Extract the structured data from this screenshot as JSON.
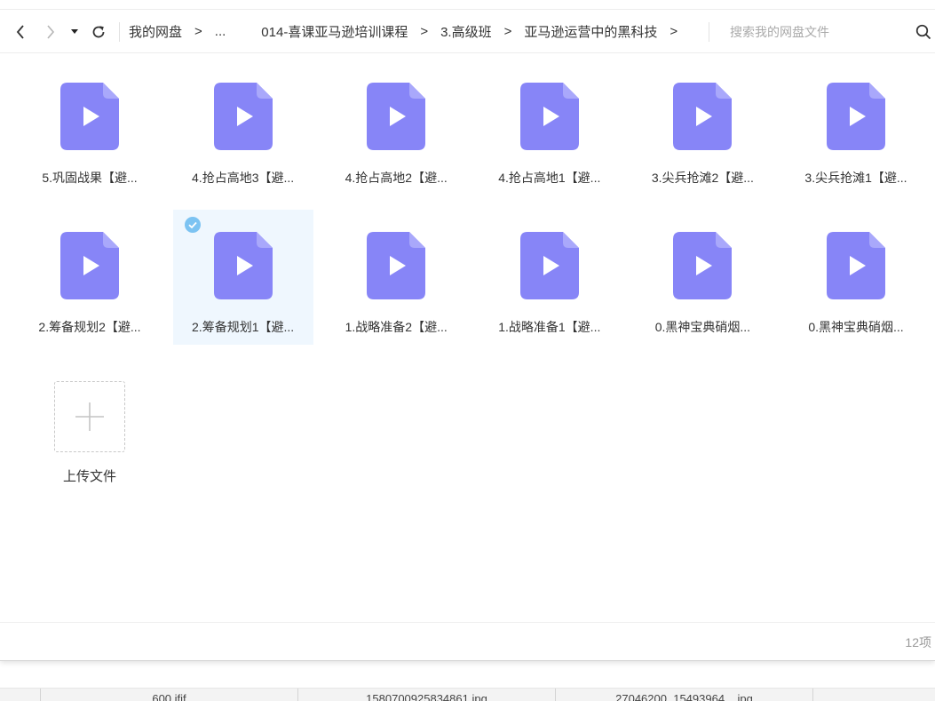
{
  "toolbar": {
    "icons": [
      "chevron-left-icon",
      "chevron-right-icon",
      "caret-down-icon",
      "refresh-icon"
    ]
  },
  "breadcrumb": {
    "items": [
      "我的网盘",
      "...",
      "014-喜课亚马逊培训课程",
      "3.高级班",
      "亚马逊运营中的黑科技"
    ],
    "separator": ">"
  },
  "search": {
    "placeholder": "搜索我的网盘文件",
    "icon": "search-icon"
  },
  "files": [
    {
      "name": "5.巩固战果【避...",
      "type": "video",
      "selected": false
    },
    {
      "name": "4.抢占高地3【避...",
      "type": "video",
      "selected": false
    },
    {
      "name": "4.抢占高地2【避...",
      "type": "video",
      "selected": false
    },
    {
      "name": "4.抢占高地1【避...",
      "type": "video",
      "selected": false
    },
    {
      "name": "3.尖兵抢滩2【避...",
      "type": "video",
      "selected": false
    },
    {
      "name": "3.尖兵抢滩1【避...",
      "type": "video",
      "selected": false
    },
    {
      "name": "2.筹备规划2【避...",
      "type": "video",
      "selected": false
    },
    {
      "name": "2.筹备规划1【避...",
      "type": "video",
      "selected": true
    },
    {
      "name": "1.战略准备2【避...",
      "type": "video",
      "selected": false
    },
    {
      "name": "1.战略准备1【避...",
      "type": "video",
      "selected": false
    },
    {
      "name": "0.黑神宝典硝烟...",
      "type": "video",
      "selected": false
    },
    {
      "name": "0.黑神宝典硝烟...",
      "type": "video",
      "selected": false
    }
  ],
  "upload": {
    "label": "上传文件"
  },
  "status": {
    "count": "12项"
  },
  "bottom_strip": [
    "600.jfif",
    "1580700925834861.jpg",
    "27046200_15493964....jpg"
  ],
  "colors": {
    "file_icon": "#8785f7",
    "selected_bg": "#eff7fe",
    "check": "#7cc3f2"
  }
}
